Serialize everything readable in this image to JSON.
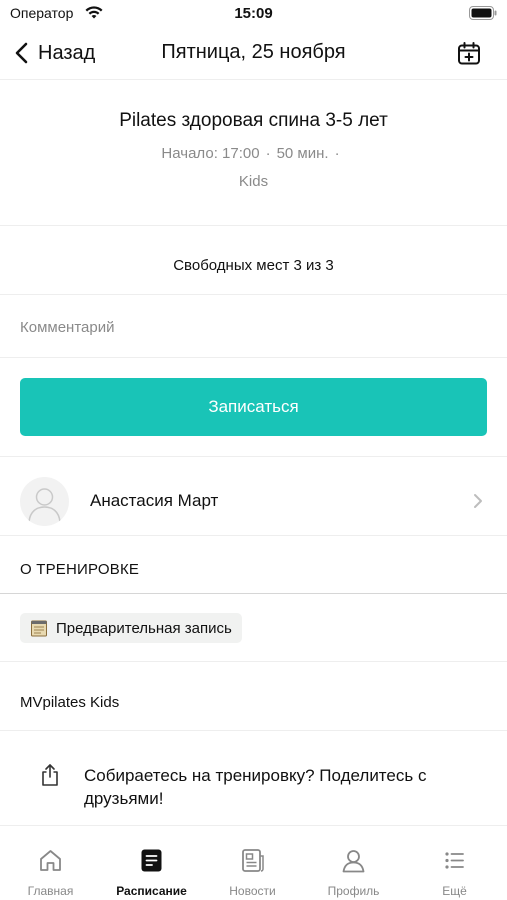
{
  "status_bar": {
    "carrier": "Оператор",
    "time": "15:09"
  },
  "nav": {
    "back_label": "Назад",
    "title": "Пятница, 25 ноября"
  },
  "class": {
    "title": "Pilates здоровая спина 3-5 лет",
    "start": "Начало: 17:00",
    "duration": "50 мин.",
    "separator": "·",
    "category": "Kids"
  },
  "slots_text": "Свободных мест 3 из 3",
  "comment": {
    "placeholder": "Комментарий",
    "value": ""
  },
  "signup_label": "Записаться",
  "trainer": {
    "name": "Анастасия Март"
  },
  "about": {
    "section_title": "О ТРЕНИРОВКЕ",
    "tag": "Предварительная запись",
    "studio": "MVpilates Kids"
  },
  "share_text": "Собираетесь на тренировку? Поделитесь с друзьями!",
  "tabs": [
    {
      "label": "Главная",
      "icon": "home-icon",
      "active": false
    },
    {
      "label": "Расписание",
      "icon": "schedule-icon",
      "active": true
    },
    {
      "label": "Новости",
      "icon": "news-icon",
      "active": false
    },
    {
      "label": "Профиль",
      "icon": "profile-icon",
      "active": false
    },
    {
      "label": "Ещё",
      "icon": "more-icon",
      "active": false
    }
  ],
  "colors": {
    "accent": "#19c4b7",
    "text": "#111111",
    "muted": "#8a8a8a",
    "divider": "#eeeeee"
  }
}
